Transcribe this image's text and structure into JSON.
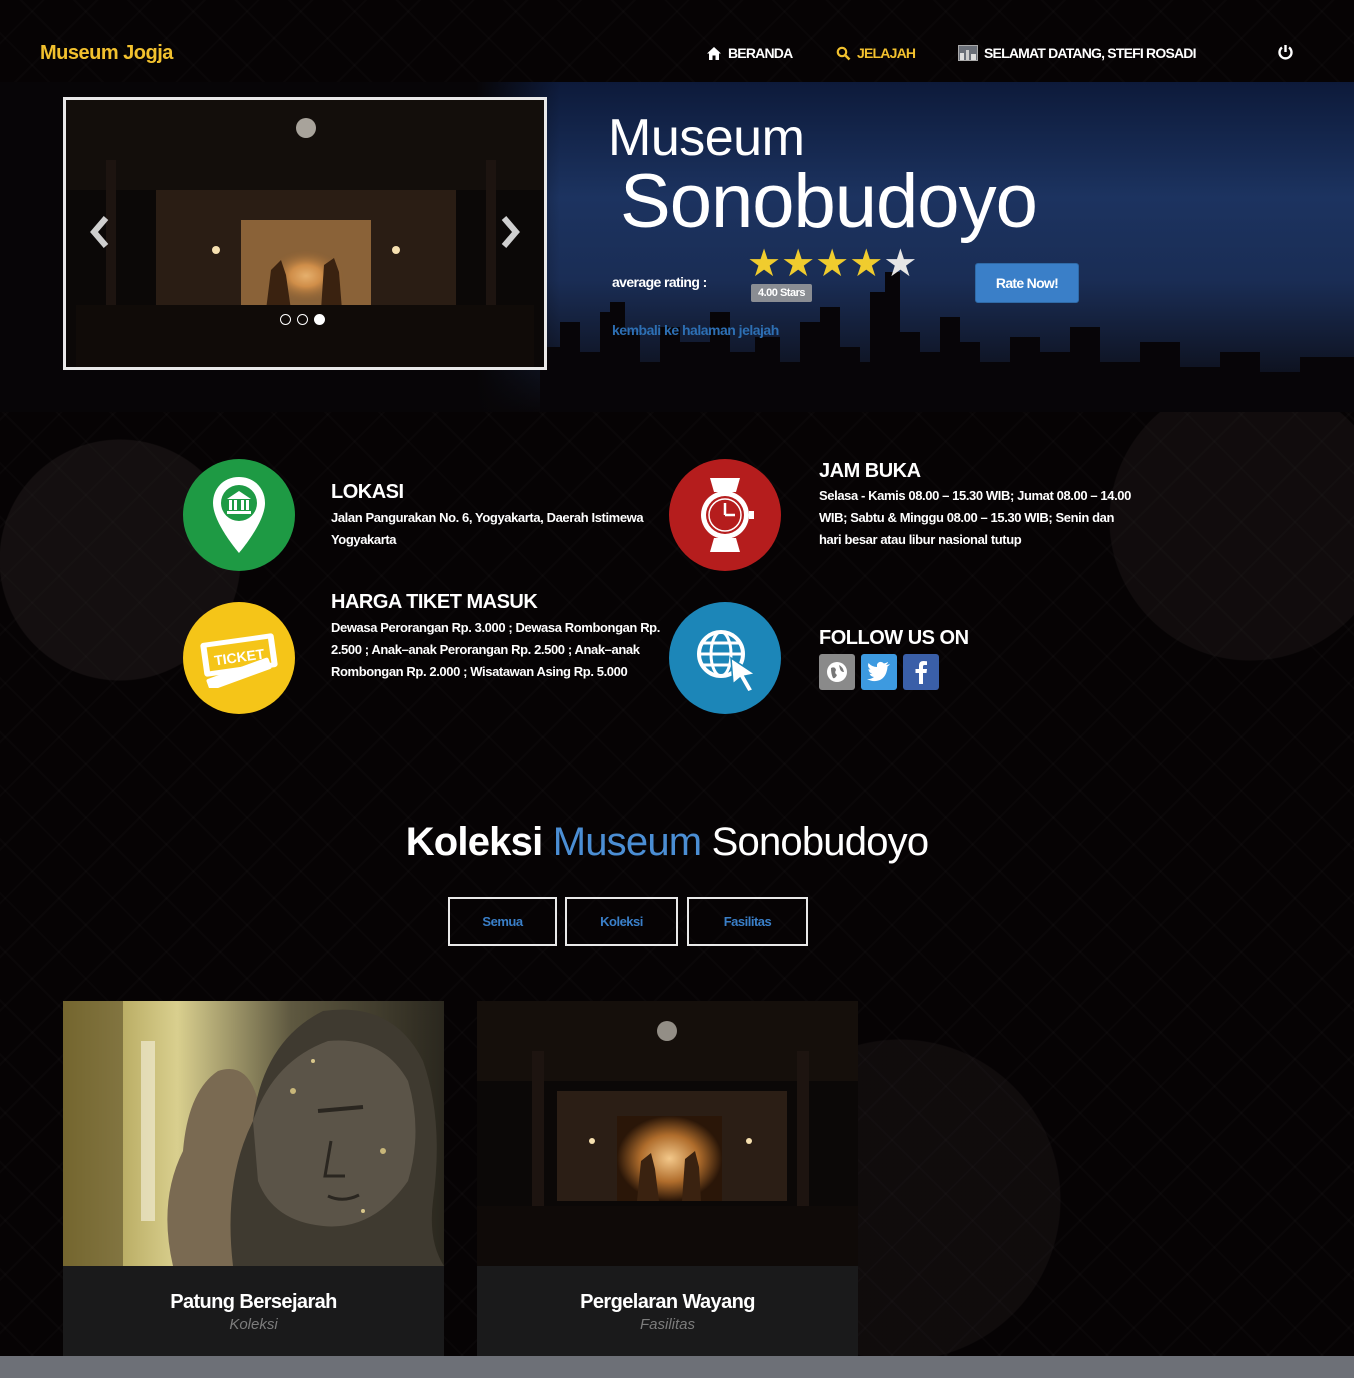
{
  "navbar": {
    "brand": "Museum Jogja",
    "home_label": "BERANDA",
    "explore_label": "JELAJAH",
    "welcome_label": "SELAMAT DATANG, STEFI ROSADI",
    "icons": [
      "home-icon",
      "search-icon",
      "user-photo-icon",
      "power-icon"
    ],
    "accent_color": "#f2c12e"
  },
  "hero": {
    "title_prefix": "Museum",
    "title_name": "Sonobudoyo",
    "average_rating_label": "average rating :",
    "rating_value": 4.0,
    "rating_max": 5,
    "rating_badge": "4.00 Stars",
    "rate_button": "Rate Now!",
    "back_link": "kembali ke halaman jelajah",
    "carousel_slides": 3,
    "carousel_active_slide": 3
  },
  "info": {
    "location": {
      "title": "LOKASI",
      "text": "Jalan Pangurakan No. 6, Yogyakarta, Daerah Istimewa Yogyakarta",
      "icon": "map-pin-museum-icon",
      "color": "#1e9a44"
    },
    "hours": {
      "title": "JAM BUKA",
      "text": "Selasa - Kamis 08.00 – 15.30 WIB; Jumat 08.00 – 14.00 WIB; Sabtu & Minggu 08.00 – 15.30 WIB; Senin dan hari besar atau libur nasional tutup",
      "icon": "wristwatch-icon",
      "color": "#b51d1d"
    },
    "ticket": {
      "title": "HARGA TIKET MASUK",
      "text": "Dewasa Perorangan Rp. 3.000 ; Dewasa Rombongan Rp. 2.500 ; Anak–anak Perorangan Rp. 2.500 ; Anak–anak Rombongan Rp. 2.000 ; Wisatawan Asing Rp. 5.000",
      "icon": "ticket-icon",
      "icon_text": "TICKET",
      "color": "#f5c518"
    },
    "follow": {
      "title": "FOLLOW US ON",
      "icon": "globe-cursor-icon",
      "color": "#1c86b8",
      "socials": [
        {
          "name": "website",
          "icon": "globe-icon",
          "color": "#8a8a8a"
        },
        {
          "name": "twitter",
          "icon": "twitter-icon",
          "color": "#3d9ae0"
        },
        {
          "name": "facebook",
          "icon": "facebook-icon",
          "color": "#3a5fa8"
        }
      ]
    }
  },
  "collection": {
    "title_part1": "Koleksi",
    "title_part2": "Museum",
    "title_part3": "Sonobudoyo",
    "filters": [
      "Semua",
      "Koleksi",
      "Fasilitas"
    ],
    "items": [
      {
        "title": "Patung Bersejarah",
        "category": "Koleksi"
      },
      {
        "title": "Pergelaran Wayang",
        "category": "Fasilitas"
      }
    ]
  }
}
